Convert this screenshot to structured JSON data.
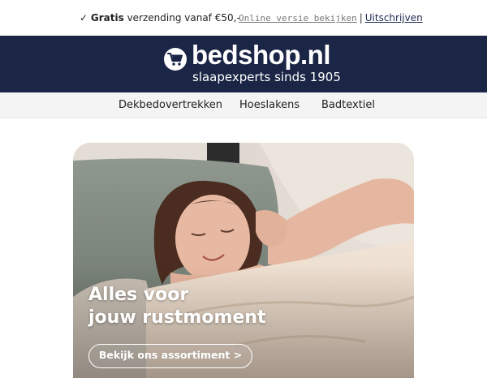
{
  "topbar": {
    "check": "✓",
    "promo_bold": "Gratis",
    "promo_text": "verzending vanaf €50,-",
    "online_link": "Online versie bekijken",
    "separator": "|",
    "unsubscribe_link": "Uitschrijven"
  },
  "header": {
    "logo_text": "bedshop.nl",
    "tagline": "slaapexperts sinds 1905",
    "logo_icon": "shopping-cart-icon",
    "bg_color": "#1b2546"
  },
  "nav": {
    "items": [
      {
        "label": "Dekbedovertrekken"
      },
      {
        "label": "Hoeslakens"
      },
      {
        "label": "Badtextiel"
      }
    ]
  },
  "hero": {
    "title_line1": "Alles voor",
    "title_line2": "jouw rustmoment",
    "button_label": "Bekijk ons assortiment >"
  }
}
